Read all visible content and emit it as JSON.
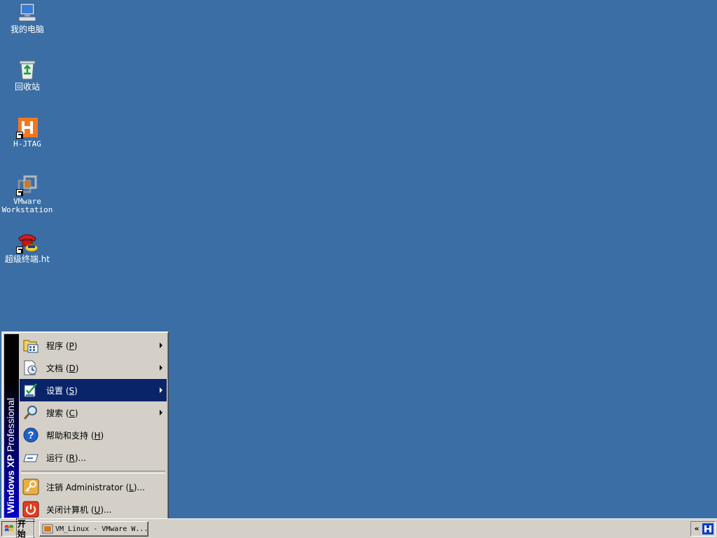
{
  "desktop": {
    "background_color": "#3a6ea5",
    "icons": [
      {
        "label": "我的电脑",
        "icon": "computer-icon"
      },
      {
        "label": "回收站",
        "icon": "recycle-bin-icon"
      },
      {
        "label": "H-JTAG",
        "icon": "hjtag-icon"
      },
      {
        "label": "VMware\nWorkstation",
        "icon": "vmware-icon"
      },
      {
        "label": "超级终端.ht",
        "icon": "hyperterminal-icon"
      }
    ]
  },
  "start_menu": {
    "banner_bold": "Windows XP",
    "banner_light": "Professional",
    "items": [
      {
        "label": "程序",
        "key": "P",
        "suffix": "",
        "icon": "programs-icon",
        "submenu": true
      },
      {
        "label": "文档",
        "key": "D",
        "suffix": "",
        "icon": "documents-icon",
        "submenu": true
      },
      {
        "label": "设置",
        "key": "S",
        "suffix": "",
        "icon": "settings-icon",
        "submenu": true,
        "selected": true
      },
      {
        "label": "搜索",
        "key": "C",
        "suffix": "",
        "icon": "search-icon",
        "submenu": true
      },
      {
        "label": "帮助和支持",
        "key": "H",
        "suffix": "",
        "icon": "help-icon",
        "submenu": false
      },
      {
        "label": "运行",
        "key": "R",
        "suffix": "...",
        "icon": "run-icon",
        "submenu": false
      }
    ],
    "bottom_items": [
      {
        "label": "注销 Administrator",
        "key": "L",
        "suffix": "...",
        "icon": "logoff-icon"
      },
      {
        "label": "关闭计算机",
        "key": "U",
        "suffix": "...",
        "icon": "shutdown-icon"
      }
    ],
    "selected_color": "#0a246a"
  },
  "taskbar": {
    "start_label": "开始",
    "task_button_label": "VM_Linux - VMware W...",
    "tray_expand": "«"
  }
}
